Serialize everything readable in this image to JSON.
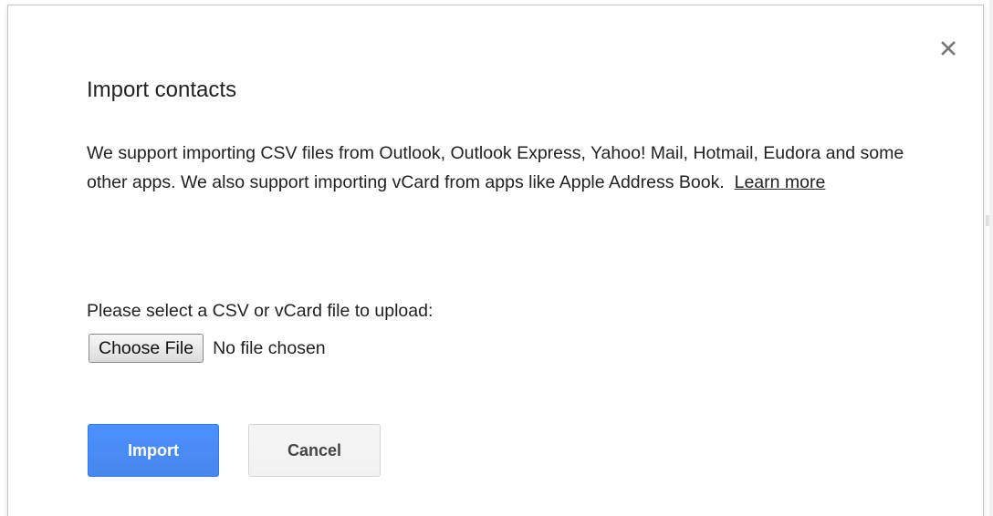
{
  "dialog": {
    "title": "Import contacts",
    "close_icon": "close-icon",
    "description": "We support importing CSV files from Outlook, Outlook Express, Yahoo! Mail, Hotmail, Eudora and some other apps. We also support importing vCard from apps like Apple Address Book.",
    "learn_more_label": "Learn more",
    "upload_prompt": "Please select a CSV or vCard file to upload:",
    "choose_file_label": "Choose File",
    "file_status": "No file chosen",
    "import_label": "Import",
    "cancel_label": "Cancel"
  },
  "colors": {
    "primary": "#4d90fe",
    "text": "#222222",
    "close_icon": "#777777"
  }
}
